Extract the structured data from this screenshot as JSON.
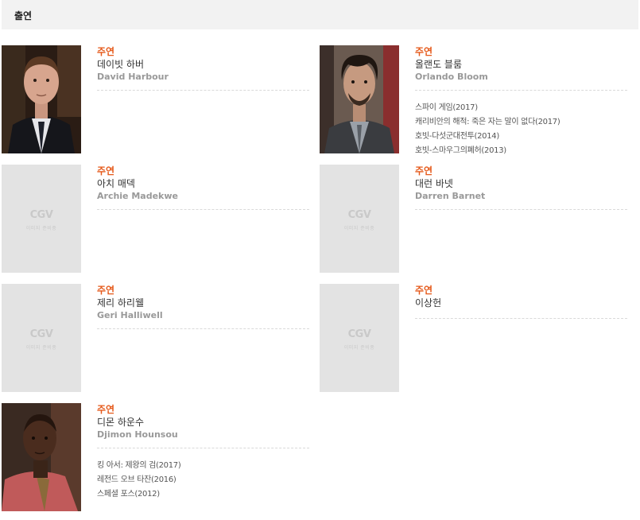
{
  "section": {
    "title": "출연"
  },
  "placeholder_logo": "CGV",
  "placeholder_caption": "이미지 준비중",
  "cast": [
    {
      "role": "주연",
      "name_ko": "데이빗 하버",
      "name_en": "David Harbour",
      "films": []
    },
    {
      "role": "주연",
      "name_ko": "올랜도 블룸",
      "name_en": "Orlando Bloom",
      "films": [
        "스파이 게임(2017)",
        "캐리비안의 해적: 죽은 자는 말이 없다(2017)",
        "호빗-다섯군대전투(2014)",
        "호빗-스마우그의폐허(2013)"
      ]
    },
    {
      "role": "주연",
      "name_ko": "아치 매덱",
      "name_en": "Archie Madekwe",
      "films": []
    },
    {
      "role": "주연",
      "name_ko": "대런 바넷",
      "name_en": "Darren Barnet",
      "films": []
    },
    {
      "role": "주연",
      "name_ko": "제리 하리웰",
      "name_en": "Geri Halliwell",
      "films": []
    },
    {
      "role": "주연",
      "name_ko": "이상헌",
      "name_en": "",
      "films": []
    },
    {
      "role": "주연",
      "name_ko": "디몬 하운수",
      "name_en": "Djimon Hounsou",
      "films": [
        "킹 아서: 제왕의 검(2017)",
        "레전드 오브 타잔(2016)",
        "스페셜 포스(2012)"
      ]
    }
  ]
}
